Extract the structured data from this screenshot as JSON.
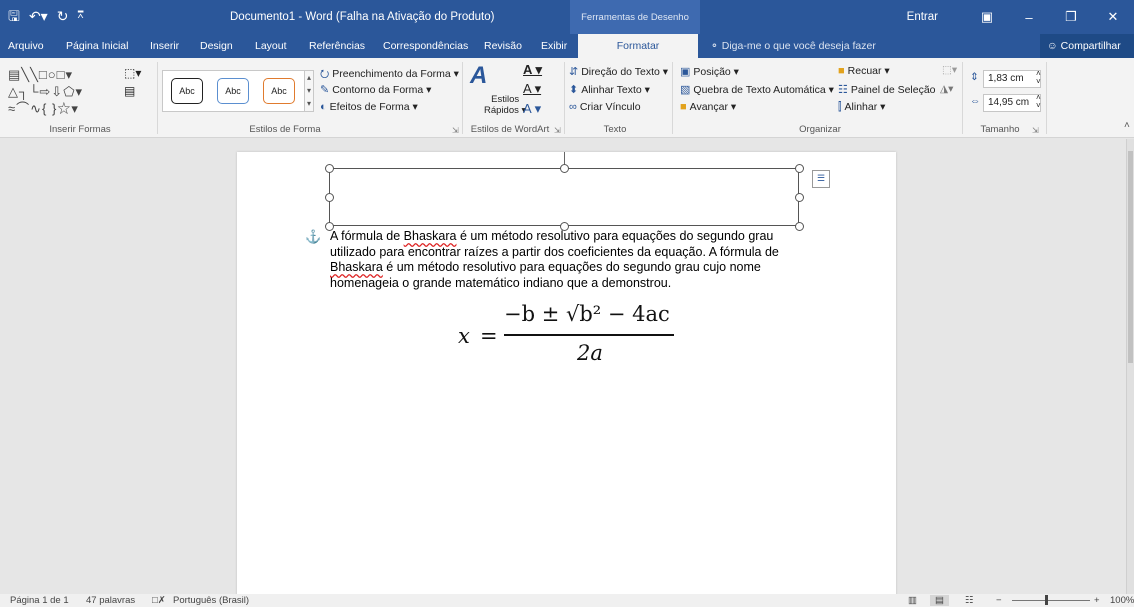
{
  "titlebar": {
    "document_title": "Documento1  -  Word (Falha na Ativação do Produto)",
    "contextual_title": "Ferramentas de Desenho",
    "signin": "Entrar",
    "icons": [
      "save-icon",
      "undo-icon",
      "redo-icon",
      "customize-qat-icon",
      "ribbon-display-icon",
      "minimize-icon",
      "restore-icon",
      "close-icon"
    ]
  },
  "tabs": [
    {
      "label": "Arquivo"
    },
    {
      "label": "Página Inicial"
    },
    {
      "label": "Inserir"
    },
    {
      "label": "Design"
    },
    {
      "label": "Layout"
    },
    {
      "label": "Referências"
    },
    {
      "label": "Correspondências"
    },
    {
      "label": "Revisão"
    },
    {
      "label": "Exibir"
    },
    {
      "label": "Formatar"
    }
  ],
  "tell_me": "Diga-me o que você deseja fazer",
  "share": "Compartilhar",
  "ribbon": {
    "groups": {
      "insert_shapes": "Inserir Formas",
      "shape_styles": "Estilos de Forma",
      "wordart_styles": "Estilos de WordArt",
      "text": "Texto",
      "arrange": "Organizar",
      "size": "Tamanho"
    },
    "style_buttons": [
      "Abc",
      "Abc",
      "Abc"
    ],
    "shape_fill": "Preenchimento da Forma",
    "shape_outline": "Contorno da Forma",
    "shape_effects": "Efeitos de Forma",
    "quick_styles_line1": "Estilos",
    "quick_styles_line2": "Rápidos",
    "text_direction": "Direção do Texto",
    "align_text": "Alinhar Texto",
    "create_link": "Criar Vínculo",
    "position": "Posição",
    "wrap_text": "Quebra de Texto Automática",
    "bring_forward": "Avançar",
    "send_backward": "Recuar",
    "selection_pane": "Painel de Seleção",
    "align": "Alinhar",
    "height": "1,83 cm",
    "width": "14,95 cm"
  },
  "document": {
    "paragraph": [
      {
        "t": "A fórmula de ",
        "spell": false
      },
      {
        "t": "Bhaskara",
        "spell": true
      },
      {
        "t": " é um método resolutivo para equações do segundo grau utilizado para encontrar raízes a partir dos coeficientes da equação. A fórmula de ",
        "spell": false
      },
      {
        "t": "Bhaskara",
        "spell": true
      },
      {
        "t": " é um método resolutivo para equações do segundo grau cujo nome homenageia o grande matemático indiano que a demonstrou.",
        "spell": false
      }
    ],
    "formula": {
      "lhs": "x",
      "eq": "=",
      "numerator": "−b ± √b² − 4ac",
      "denominator": "2a"
    }
  },
  "status": {
    "page": "Página 1 de 1",
    "words": "47 palavras",
    "language": "Português (Brasil)",
    "zoom": "100%"
  }
}
